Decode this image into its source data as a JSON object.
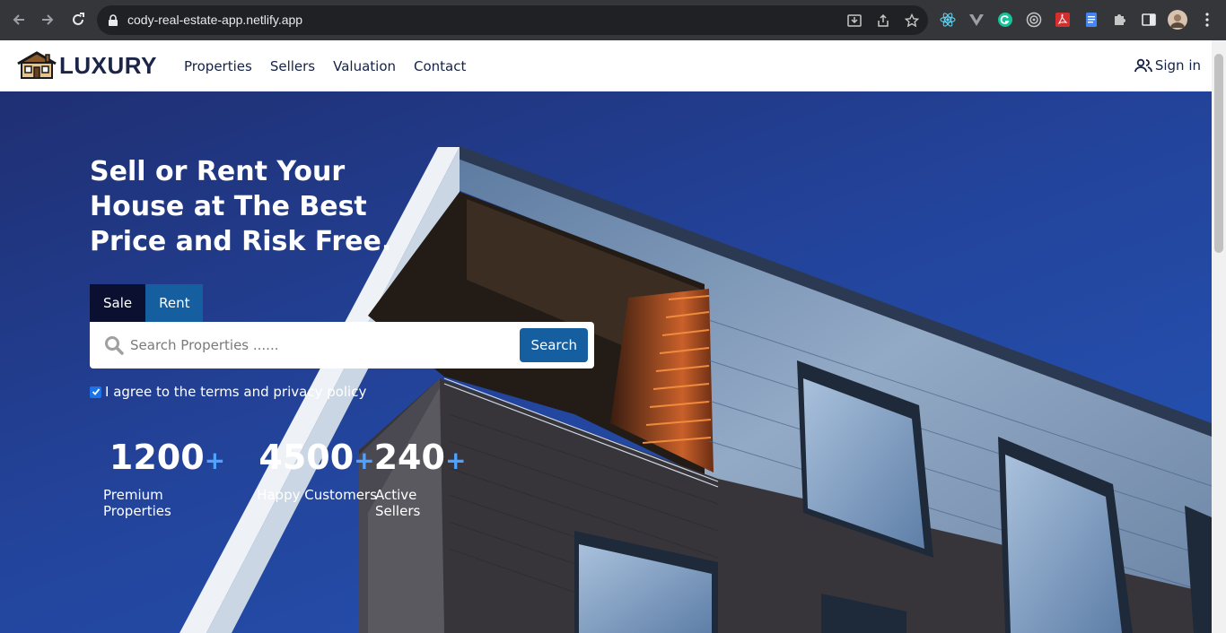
{
  "browser": {
    "url": "cody-real-estate-app.netlify.app"
  },
  "navbar": {
    "logo_text": "LUXURY",
    "links": [
      "Properties",
      "Sellers",
      "Valuation",
      "Contact"
    ],
    "signin_label": "Sign in"
  },
  "hero": {
    "headline": "Sell or Rent Your House at The Best Price and Risk Free.",
    "tabs": [
      {
        "label": "Sale",
        "active": true
      },
      {
        "label": "Rent",
        "active": false
      }
    ],
    "search": {
      "placeholder": "Search Properties ......",
      "button_label": "Search"
    },
    "agree_label": "I agree to the terms and privacy policy",
    "agree_checked": true,
    "stats": [
      {
        "value": "1200",
        "plus": "+",
        "label": "Premium Properties"
      },
      {
        "value": "4500",
        "plus": "+",
        "label": "Happy Customers"
      },
      {
        "value": "240",
        "plus": "+",
        "label": "Active Sellers"
      }
    ]
  },
  "colors": {
    "brand_dark": "#152247",
    "accent": "#155ea0",
    "hero_blue": "#2456b8",
    "plus_blue": "#4fa3ff"
  }
}
